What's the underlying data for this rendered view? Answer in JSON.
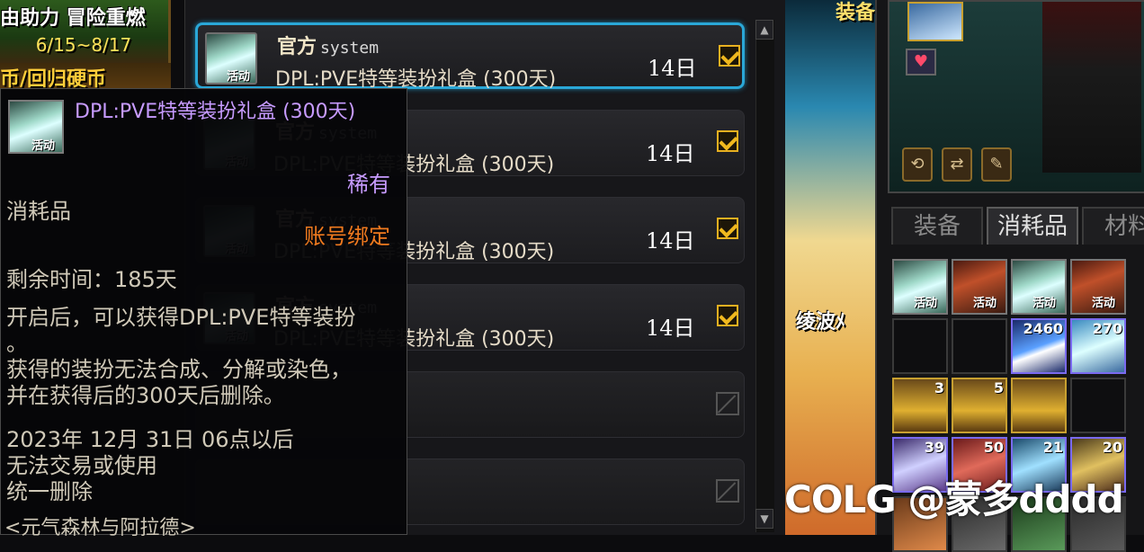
{
  "banner": {
    "title_text": "由助力 冒险重燃",
    "date_range": "6/15~8/17",
    "strip_text": "币/回归硬币"
  },
  "mail": {
    "rows": [
      {
        "sender": "官方",
        "sender_sub": "system",
        "title": "DPL:PVE特等装扮礼盒 (300天)",
        "days": "14日",
        "checked": true,
        "icon_tag": "活动"
      },
      {
        "sender": "官方",
        "sender_sub": "system",
        "title": "DPL:PVE特等装扮礼盒 (300天)",
        "days": "14日",
        "checked": true,
        "icon_tag": "活动"
      },
      {
        "sender": "官方",
        "sender_sub": "system",
        "title": "DPL:PVE特等装扮礼盒 (300天)",
        "days": "14日",
        "checked": true,
        "icon_tag": "活动"
      },
      {
        "sender": "官方",
        "sender_sub": "system",
        "title": "DPL:PVE特等装扮礼盒 (300天)",
        "days": "14日",
        "checked": true,
        "icon_tag": "活动"
      }
    ]
  },
  "tooltip": {
    "icon_tag": "活动",
    "item_name": "DPL:PVE特等装扮礼盒 (300天)",
    "rarity": "稀有",
    "type": "消耗品",
    "binding": "账号绑定",
    "remaining": "剩余时间：185天",
    "description": "开启后，可以获得DPL:PVE特等装扮\n。\n获得的装扮无法合成、分解或染色，\n并在获得后的300天后删除。",
    "expiry": "2023年 12月 31日 06点以后\n无法交易或使用\n统一删除",
    "source": "<元气森林与阿拉德>"
  },
  "scene": {
    "label_top": "装备",
    "label_char": "绫波ﾒ"
  },
  "inventory": {
    "tabs": [
      "装备",
      "消耗品",
      "材料"
    ],
    "active_tab": "消耗品",
    "slots_row1": [
      {
        "tag": "活动"
      },
      {
        "tag": "活动"
      },
      {
        "tag": "活动"
      },
      {
        "tag": "活动"
      }
    ],
    "counts_row2": [
      "",
      "",
      "2460",
      "270"
    ],
    "counts_row3": [
      "3",
      "5",
      "",
      ""
    ],
    "counts_row4": [
      "39",
      "50",
      "21",
      "20"
    ],
    "slot_tag": "活动"
  },
  "watermark": {
    "text": "COLG @蒙多dddd"
  }
}
